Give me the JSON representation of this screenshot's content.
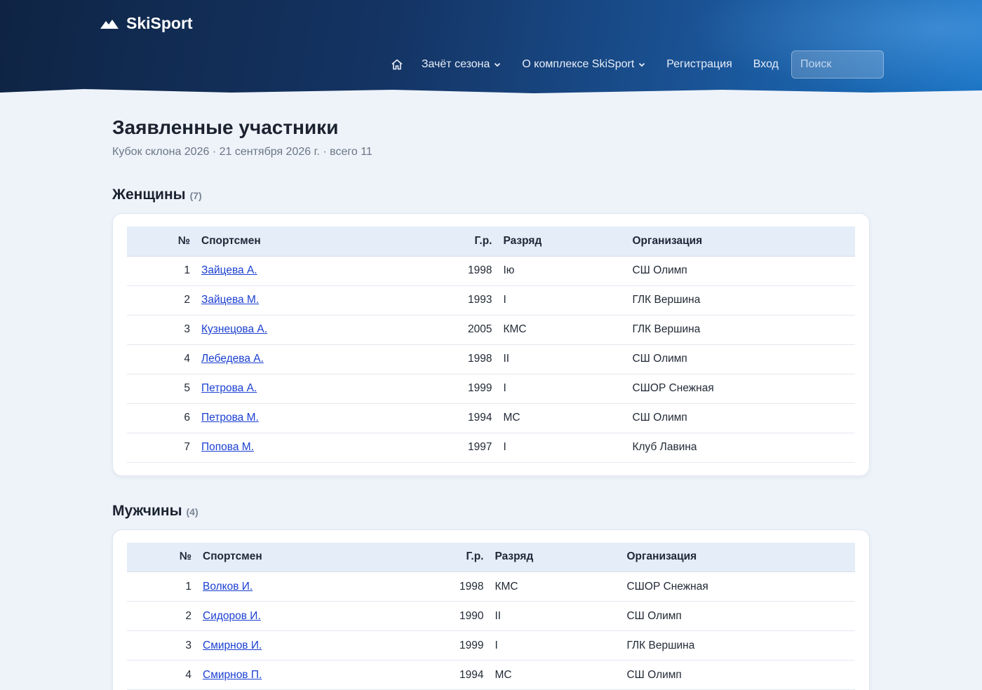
{
  "brand": {
    "name": "SkiSport"
  },
  "nav": {
    "home_icon": "home-icon",
    "items": [
      {
        "label": "Зачёт сезона",
        "dropdown": true
      },
      {
        "label": "О комплексе SkiSport",
        "dropdown": true
      },
      {
        "label": "Регистрация",
        "dropdown": false
      },
      {
        "label": "Вход",
        "dropdown": false
      }
    ],
    "search_placeholder": "Поиск"
  },
  "page": {
    "title": "Заявленные участники",
    "subtitle": "Кубок склона 2026 · 21 сентября 2026 г. · всего 11"
  },
  "columns": {
    "num": "№",
    "athlete": "Спортсмен",
    "year": "Г.р.",
    "rank": "Разряд",
    "org": "Организация"
  },
  "women": {
    "title": "Женщины",
    "count": "(7)",
    "rows": [
      {
        "num": "1",
        "name": "Зайцева А.",
        "year": "1998",
        "rank": "Iю",
        "org": "СШ Олимп"
      },
      {
        "num": "2",
        "name": "Зайцева М.",
        "year": "1993",
        "rank": "I",
        "org": "ГЛК Вершина"
      },
      {
        "num": "3",
        "name": "Кузнецова А.",
        "year": "2005",
        "rank": "КМС",
        "org": "ГЛК Вершина"
      },
      {
        "num": "4",
        "name": "Лебедева А.",
        "year": "1998",
        "rank": "II",
        "org": "СШ Олимп"
      },
      {
        "num": "5",
        "name": "Петрова А.",
        "year": "1999",
        "rank": "I",
        "org": "СШОР Снежная"
      },
      {
        "num": "6",
        "name": "Петрова М.",
        "year": "1994",
        "rank": "МС",
        "org": "СШ Олимп"
      },
      {
        "num": "7",
        "name": "Попова М.",
        "year": "1997",
        "rank": "I",
        "org": "Клуб Лавина"
      }
    ]
  },
  "men": {
    "title": "Мужчины",
    "count": "(4)",
    "rows": [
      {
        "num": "1",
        "name": "Волков И.",
        "year": "1998",
        "rank": "КМС",
        "org": "СШОР Снежная"
      },
      {
        "num": "2",
        "name": "Сидоров И.",
        "year": "1990",
        "rank": "II",
        "org": "СШ Олимп"
      },
      {
        "num": "3",
        "name": "Смирнов И.",
        "year": "1999",
        "rank": "I",
        "org": "ГЛК Вершина"
      },
      {
        "num": "4",
        "name": "Смирнов П.",
        "year": "1994",
        "rank": "МС",
        "org": "СШ Олимп"
      }
    ]
  }
}
